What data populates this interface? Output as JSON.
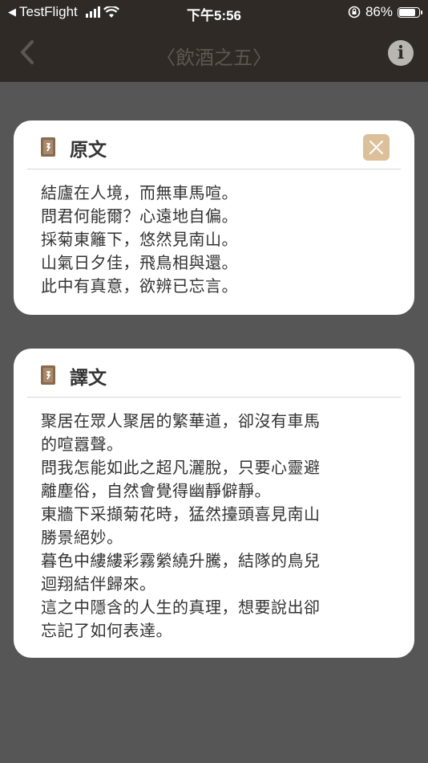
{
  "status_bar": {
    "carrier": "TestFlight",
    "time": "下午5:56",
    "battery_percent": "86%",
    "battery_level": 0.86
  },
  "nav": {
    "title": "〈飲酒之五〉",
    "back_icon": "chevron-left-icon",
    "info_icon": "info-icon"
  },
  "original": {
    "title": "原文",
    "close_icon": "close-icon",
    "lines": [
      "結廬在人境，而無車馬喧。",
      "問君何能爾？心遠地自偏。",
      "採菊東籬下，悠然見南山。",
      "山氣日夕佳，飛鳥相與還。",
      "此中有真意，欲辨已忘言。"
    ]
  },
  "translation": {
    "title": "譯文",
    "lines": [
      "聚居在眾人聚居的繁華道，卻沒有車馬",
      "的喧囂聲。",
      "問我怎能如此之超凡灑脫，只要心靈避",
      "離塵俗，自然會覺得幽靜僻靜。",
      "東牆下采擷菊花時，猛然擡頭喜見南山",
      "勝景絕妙。",
      "暮色中縷縷彩霧縈繞升騰，結隊的鳥兒",
      "迴翔結伴歸來。",
      "這之中隱含的人生的真理，想要說出卻",
      "忘記了如何表達。"
    ]
  },
  "colors": {
    "header_bg": "#2f2a25",
    "overlay_bg": "#565656",
    "accent": "#dcc09a",
    "icon_brown": "#8a6a4e"
  }
}
